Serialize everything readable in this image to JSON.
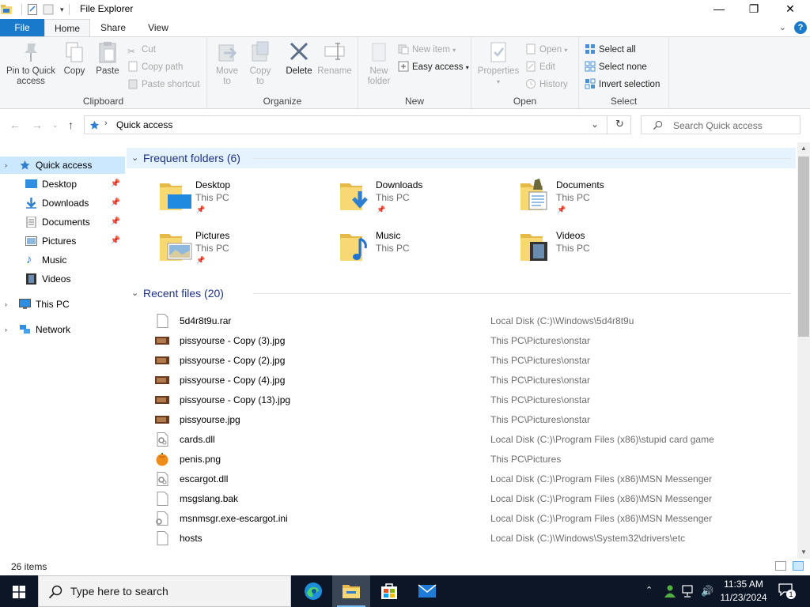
{
  "window": {
    "title": "File Explorer",
    "controls": {
      "minimize": "—",
      "maximize": "❐",
      "close": "✕"
    }
  },
  "ribbon": {
    "tabs": {
      "file": "File",
      "home": "Home",
      "share": "Share",
      "view": "View"
    },
    "help": "?",
    "clipboard": {
      "label": "Clipboard",
      "pin": "Pin to Quick access",
      "copy": "Copy",
      "paste": "Paste",
      "cut": "Cut",
      "copy_path": "Copy path",
      "paste_shortcut": "Paste shortcut"
    },
    "organize": {
      "label": "Organize",
      "move_to": "Move to",
      "copy_to": "Copy to",
      "delete": "Delete",
      "rename": "Rename"
    },
    "new": {
      "label": "New",
      "new_folder": "New folder",
      "new_item": "New item",
      "easy_access": "Easy access"
    },
    "open": {
      "label": "Open",
      "properties": "Properties",
      "open": "Open",
      "edit": "Edit",
      "history": "History"
    },
    "select": {
      "label": "Select",
      "select_all": "Select all",
      "select_none": "Select none",
      "invert": "Invert selection"
    }
  },
  "address": {
    "path": "Quick access",
    "search_placeholder": "Search Quick access"
  },
  "nav_pane": {
    "items": [
      {
        "label": "Quick access",
        "icon": "star-icon",
        "pinned": false
      },
      {
        "label": "Desktop",
        "icon": "desktop-icon",
        "pinned": true
      },
      {
        "label": "Downloads",
        "icon": "download-icon",
        "pinned": true
      },
      {
        "label": "Documents",
        "icon": "document-icon",
        "pinned": true
      },
      {
        "label": "Pictures",
        "icon": "pictures-icon",
        "pinned": true
      },
      {
        "label": "Music",
        "icon": "music-icon",
        "pinned": false
      },
      {
        "label": "Videos",
        "icon": "videos-icon",
        "pinned": false
      },
      {
        "label": "This PC",
        "icon": "computer-icon",
        "pinned": false
      },
      {
        "label": "Network",
        "icon": "network-icon",
        "pinned": false
      }
    ]
  },
  "frequent": {
    "heading": "Frequent folders (6)",
    "folders": [
      {
        "name": "Desktop",
        "location": "This PC",
        "pinned": true,
        "icon": "desktop-folder-icon"
      },
      {
        "name": "Downloads",
        "location": "This PC",
        "pinned": true,
        "icon": "downloads-folder-icon"
      },
      {
        "name": "Documents",
        "location": "This PC",
        "pinned": true,
        "icon": "documents-folder-icon"
      },
      {
        "name": "Pictures",
        "location": "This PC",
        "pinned": true,
        "icon": "pictures-folder-icon"
      },
      {
        "name": "Music",
        "location": "This PC",
        "pinned": false,
        "icon": "music-folder-icon"
      },
      {
        "name": "Videos",
        "location": "This PC",
        "pinned": false,
        "icon": "videos-folder-icon"
      }
    ]
  },
  "recent": {
    "heading": "Recent files (20)",
    "files": [
      {
        "name": "5d4r8t9u.rar",
        "path": "Local Disk (C:)\\Windows\\5d4r8t9u",
        "icon": "blank-file-icon"
      },
      {
        "name": "pissyourse - Copy (3).jpg",
        "path": "This PC\\Pictures\\onstar",
        "icon": "image-file-icon"
      },
      {
        "name": "pissyourse - Copy (2).jpg",
        "path": "This PC\\Pictures\\onstar",
        "icon": "image-file-icon"
      },
      {
        "name": "pissyourse - Copy (4).jpg",
        "path": "This PC\\Pictures\\onstar",
        "icon": "image-file-icon"
      },
      {
        "name": "pissyourse - Copy (13).jpg",
        "path": "This PC\\Pictures\\onstar",
        "icon": "image-file-icon"
      },
      {
        "name": "pissyourse.jpg",
        "path": "This PC\\Pictures\\onstar",
        "icon": "image-file-icon"
      },
      {
        "name": "cards.dll",
        "path": "Local Disk (C:)\\Program Files (x86)\\stupid card game",
        "icon": "dll-file-icon"
      },
      {
        "name": "penis.png",
        "path": "This PC\\Pictures",
        "icon": "png-file-icon"
      },
      {
        "name": "escargot.dll",
        "path": "Local Disk (C:)\\Program Files (x86)\\MSN Messenger",
        "icon": "dll-file-icon"
      },
      {
        "name": "msgslang.bak",
        "path": "Local Disk (C:)\\Program Files (x86)\\MSN Messenger",
        "icon": "blank-file-icon"
      },
      {
        "name": "msnmsgr.exe-escargot.ini",
        "path": "Local Disk (C:)\\Program Files (x86)\\MSN Messenger",
        "icon": "ini-file-icon"
      },
      {
        "name": "hosts",
        "path": "Local Disk (C:)\\Windows\\System32\\drivers\\etc",
        "icon": "blank-file-icon"
      }
    ]
  },
  "status": {
    "item_count": "26 items"
  },
  "taskbar": {
    "search_placeholder": "Type here to search",
    "time": "11:35 AM",
    "date": "11/23/2024",
    "notification_count": "1",
    "apps": [
      "edge-icon",
      "file-explorer-icon",
      "store-icon",
      "mail-icon"
    ]
  },
  "colors": {
    "accent": "#1979ca",
    "selection": "#cce8ff",
    "section_heading": "#1e3287",
    "folder_yellow": "#f8d775",
    "taskbar": "#0c1626"
  }
}
